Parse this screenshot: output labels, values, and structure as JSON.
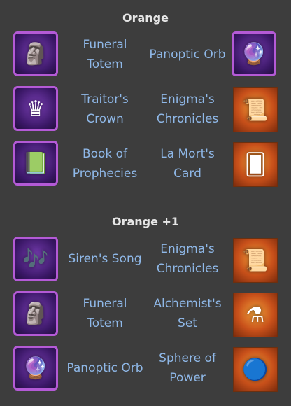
{
  "sections": [
    {
      "title": "Orange",
      "rows": [
        {
          "left": {
            "name": "Funeral\nTotem",
            "icon": "totem-icon"
          },
          "right": {
            "name": "Panoptic Orb",
            "icon": "orb-icon"
          }
        },
        {
          "left": {
            "name": "Traitor's\nCrown",
            "icon": "crown-icon"
          },
          "right": {
            "name": "Enigma's\nChronicles",
            "icon": "scroll-icon"
          }
        },
        {
          "left": {
            "name": "Book of\nProphecies",
            "icon": "book-icon"
          },
          "right": {
            "name": "La Mort's\nCard",
            "icon": "card-icon"
          }
        }
      ]
    },
    {
      "title": "Orange +1",
      "rows": [
        {
          "left": {
            "name": "Siren's Song",
            "icon": "flute-icon"
          },
          "right": {
            "name": "Enigma's\nChronicles",
            "icon": "scroll-icon"
          }
        },
        {
          "left": {
            "name": "Funeral\nTotem",
            "icon": "totem-icon"
          },
          "right": {
            "name": "Alchemist's\nSet",
            "icon": "potion-belt-icon"
          }
        },
        {
          "left": {
            "name": "Panoptic Orb",
            "icon": "orb-icon"
          },
          "right": {
            "name": "Sphere of\nPower",
            "icon": "sphere-icon"
          }
        }
      ]
    }
  ]
}
